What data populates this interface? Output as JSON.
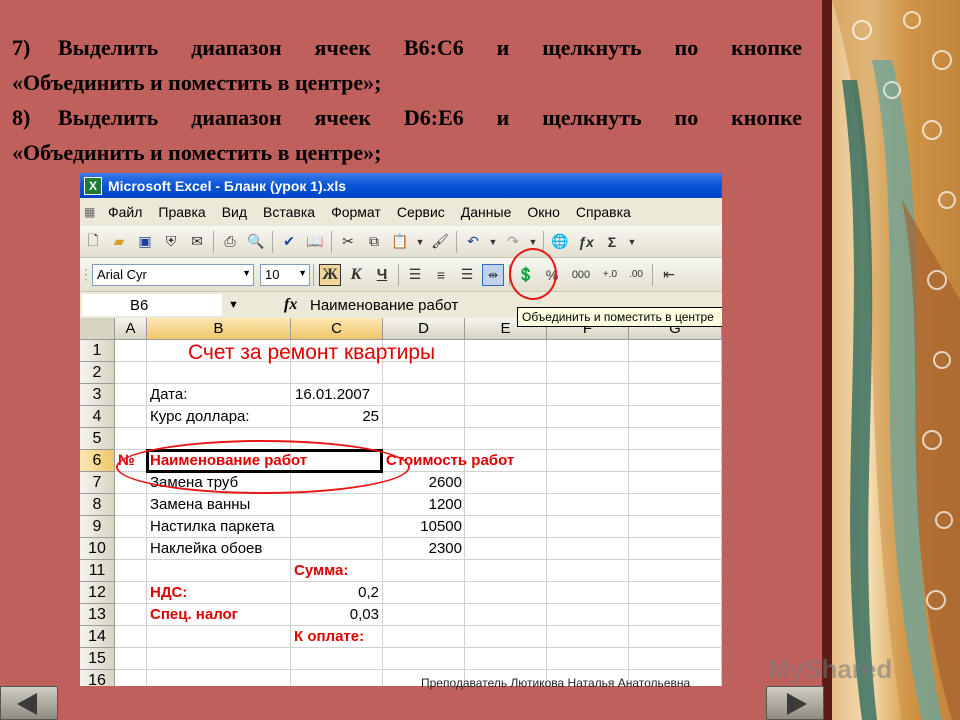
{
  "slide": {
    "instructions": [
      {
        "num": "7)",
        "text": "Выделить диапазон ячеек B6:C6 и щелкнуть по кнопке",
        "cont": "«Объединить и поместить в центре»;"
      },
      {
        "num": "8)",
        "text": "Выделить диапазон ячеек D6:E6 и щелкнуть по кнопке",
        "cont": "«Объединить и поместить в центре»;"
      }
    ],
    "footer": "Преподаватель Лютикова Наталья Анатольевна",
    "watermark": "MyShared",
    "colors": {
      "background": "#c0605c",
      "accent_red": "#e81818"
    }
  },
  "excel": {
    "title": "Microsoft Excel - Бланк (урок 1).xls",
    "app_icon": "X",
    "menu": [
      "Файл",
      "Правка",
      "Вид",
      "Вставка",
      "Формат",
      "Сервис",
      "Данные",
      "Окно",
      "Справка"
    ],
    "toolbar1_icons": [
      "new-icon",
      "open-icon",
      "save-icon",
      "permission-icon",
      "email-icon",
      "print-icon",
      "print-preview-icon",
      "spelling-icon",
      "research-icon",
      "cut-icon",
      "copy-icon",
      "paste-icon",
      "format-painter-icon",
      "undo-icon",
      "redo-icon",
      "hyperlink-icon",
      "function-icon",
      "autosum-icon"
    ],
    "font_name": "Arial Cyr",
    "font_size": "10",
    "format_buttons": {
      "bold": "Ж",
      "italic": "К",
      "underline": "Ч"
    },
    "percent_label": "%",
    "thousands_label": "000",
    "name_box": "B6",
    "fx_label": "fx",
    "formula": "Наименование работ",
    "tooltip": "Объединить и поместить в центре",
    "columns": [
      "A",
      "B",
      "C",
      "D",
      "E",
      "F",
      "G"
    ],
    "rows": [
      "1",
      "2",
      "3",
      "4",
      "5",
      "6",
      "7",
      "8",
      "9",
      "10",
      "11",
      "12",
      "13",
      "14",
      "15",
      "16"
    ],
    "cells": {
      "title": "Счет за ремонт квартиры",
      "date_label": "Дата:",
      "date_value": "16.01.2007",
      "rate_label": "Курс доллара:",
      "rate_value": "25",
      "num_header": "№",
      "name_header": "Наименование работ",
      "cost_header": "Стоимость работ",
      "items": [
        {
          "name": "Замена труб",
          "cost": "2600"
        },
        {
          "name": "Замена ванны",
          "cost": "1200"
        },
        {
          "name": "Настилка паркета",
          "cost": "10500"
        },
        {
          "name": "Наклейка обоев",
          "cost": "2300"
        }
      ],
      "sum_label": "Сумма:",
      "vat_label": "НДС:",
      "vat_value": "0,2",
      "tax_label": "Спец. налог",
      "tax_value": "0,03",
      "pay_label": "К оплате:"
    }
  }
}
